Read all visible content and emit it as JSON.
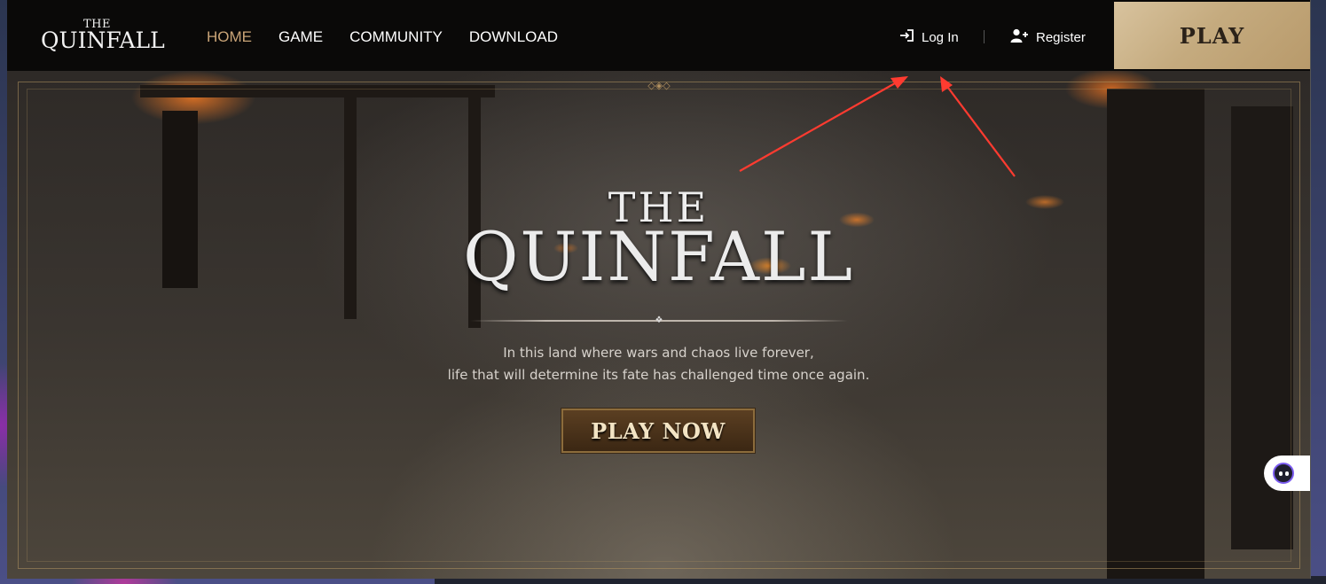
{
  "nav": {
    "logo_the": "THE",
    "logo_main": "QUINFALL",
    "menu": [
      {
        "label": "HOME",
        "active": true
      },
      {
        "label": "GAME",
        "active": false
      },
      {
        "label": "COMMUNITY",
        "active": false
      },
      {
        "label": "DOWNLOAD",
        "active": false
      }
    ],
    "login_label": "Log In",
    "register_label": "Register",
    "play_label": "PLAY"
  },
  "hero": {
    "the": "THE",
    "title": "QUINFALL",
    "tagline_line1": "In this land where wars and chaos live forever,",
    "tagline_line2": "life that will determine its fate has challenged time once again.",
    "cta_label": "PLAY NOW"
  },
  "colors": {
    "nav_bg": "#0a0908",
    "active_menu": "#c9a477",
    "play_button": "#c5ab7f",
    "cta_bg": "#4a321a",
    "annotation_arrow": "#ff3b30"
  },
  "icons": {
    "login": "login-icon",
    "register": "user-plus-icon",
    "chat": "chat-bot-icon"
  }
}
